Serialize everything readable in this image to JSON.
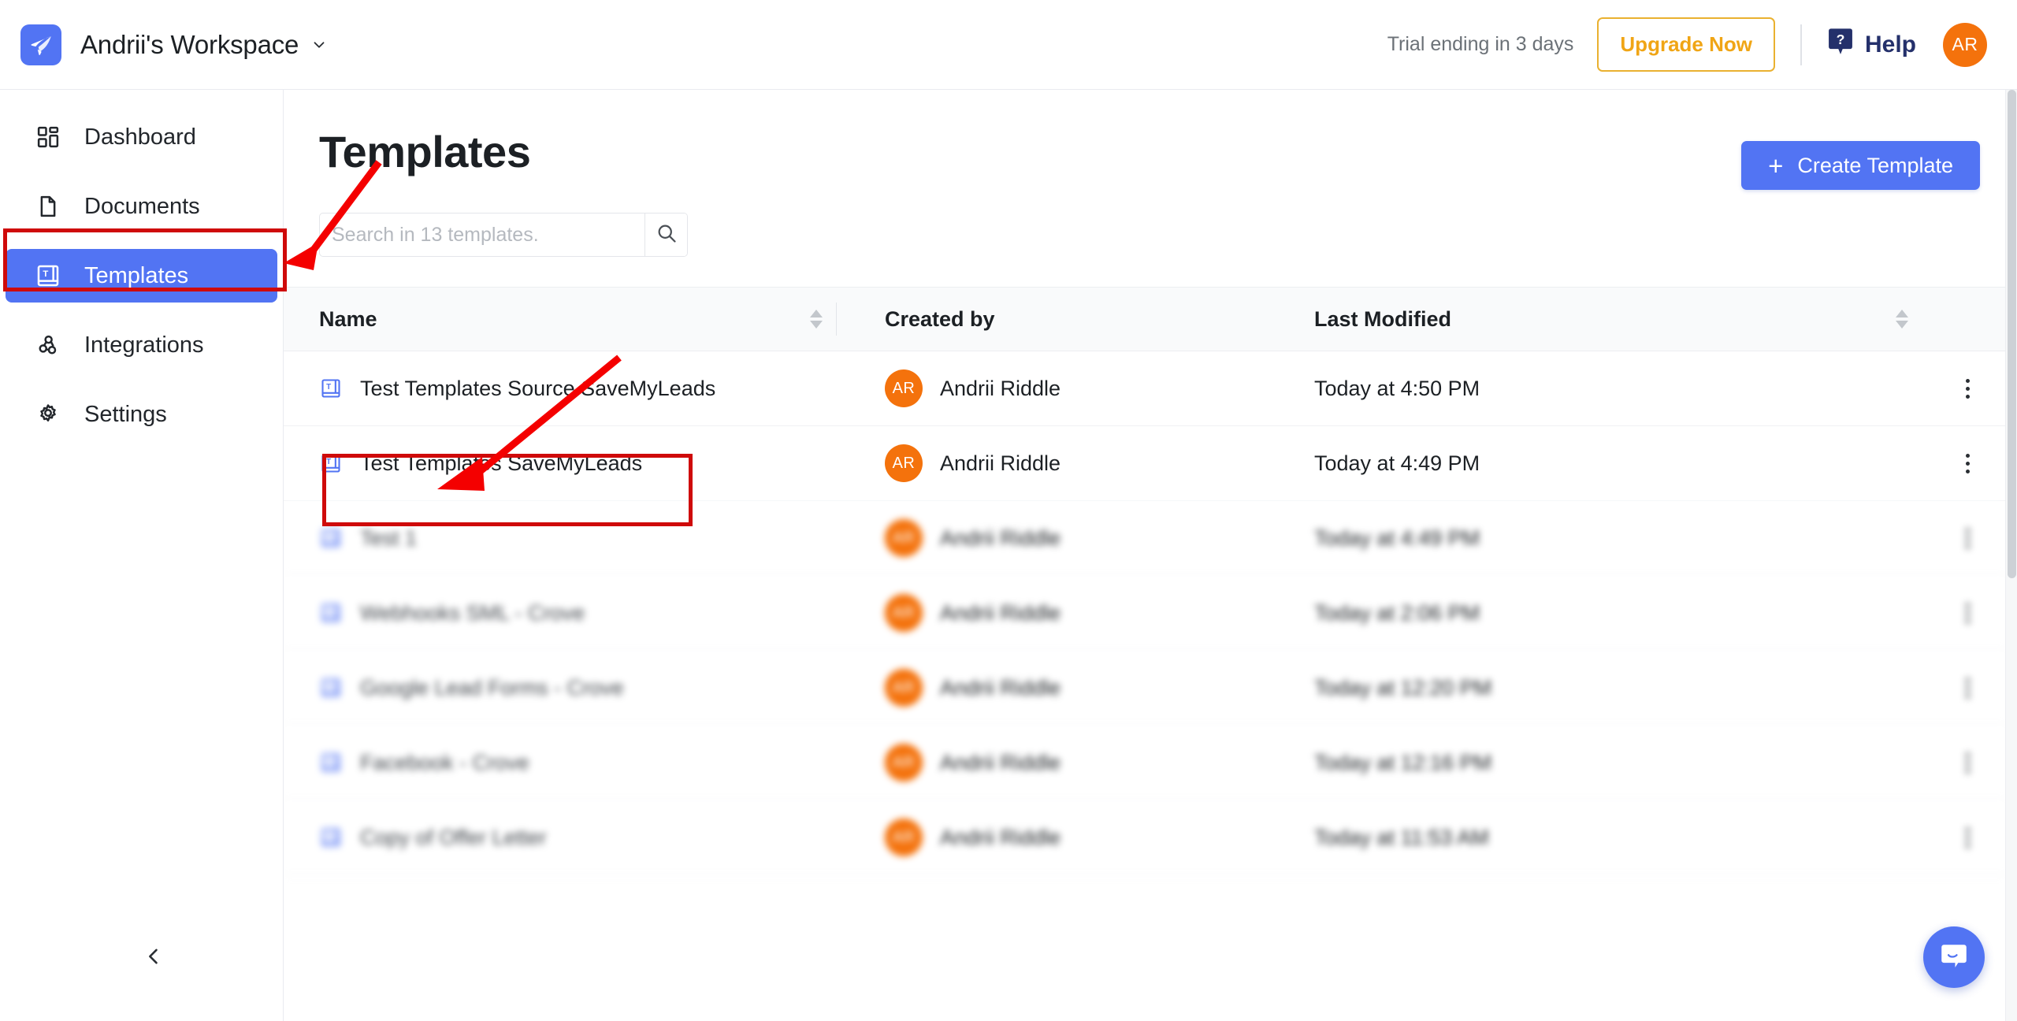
{
  "topbar": {
    "logo_icon": "paper-bird-logo-icon",
    "workspace_name": "Andrii's Workspace",
    "workspace_caret_icon": "chevron-down-icon",
    "trial_text": "Trial ending in 3 days",
    "upgrade_label": "Upgrade Now",
    "help_icon": "help-question-badge-icon",
    "help_label": "Help",
    "avatar_initials": "AR",
    "accent_blue": "#5274f3",
    "accent_orange": "#f4720c",
    "upgrade_amber": "#f0a515",
    "help_navy": "#24306b"
  },
  "sidebar": {
    "items": [
      {
        "label": "Dashboard",
        "icon": "grid-dashboard-icon",
        "active": false
      },
      {
        "label": "Documents",
        "icon": "document-page-icon",
        "active": false
      },
      {
        "label": "Templates",
        "icon": "template-book-icon",
        "active": true
      },
      {
        "label": "Integrations",
        "icon": "webhook-icon",
        "active": false
      },
      {
        "label": "Settings",
        "icon": "gear-icon",
        "active": false
      }
    ],
    "collapse_icon": "chevron-left-icon"
  },
  "main": {
    "title": "Templates",
    "create_button": {
      "label": "Create Template",
      "icon": "plus-icon"
    },
    "search": {
      "placeholder": "Search in 13 templates.",
      "value": "",
      "icon": "search-icon"
    }
  },
  "table": {
    "columns": [
      {
        "key": "name",
        "label": "Name",
        "sortable": true
      },
      {
        "key": "created_by",
        "label": "Created by",
        "sortable": false
      },
      {
        "key": "last_modified",
        "label": "Last Modified",
        "sortable": true
      }
    ],
    "row_menu_icon": "kebab-menu-icon",
    "sort_icon": "sort-arrows-icon",
    "rows": [
      {
        "name": "Test Templates Source SaveMyLeads",
        "icon": "template-book-icon",
        "blurred": false,
        "created_by": "Andrii Riddle",
        "avatar": "AR",
        "last_modified": "Today at 4:50 PM"
      },
      {
        "name": "Test Templates SaveMyLeads",
        "icon": "template-book-icon",
        "blurred": false,
        "created_by": "Andrii Riddle",
        "avatar": "AR",
        "last_modified": "Today at 4:49 PM"
      },
      {
        "name": "Test 1",
        "icon": "template-book-icon",
        "blurred": true,
        "created_by": "Andrii Riddle",
        "avatar": "AR",
        "last_modified": "Today at 4:49 PM"
      },
      {
        "name": "Webhooks SML - Crove",
        "icon": "template-book-icon",
        "blurred": true,
        "created_by": "Andrii Riddle",
        "avatar": "AR",
        "last_modified": "Today at 2:06 PM"
      },
      {
        "name": "Google Lead Forms - Crove",
        "icon": "template-book-icon",
        "blurred": true,
        "created_by": "Andrii Riddle",
        "avatar": "AR",
        "last_modified": "Today at 12:20 PM"
      },
      {
        "name": "Facebook - Crove",
        "icon": "template-book-icon",
        "blurred": true,
        "created_by": "Andrii Riddle",
        "avatar": "AR",
        "last_modified": "Today at 12:16 PM"
      },
      {
        "name": "Copy of  Offer Letter",
        "icon": "template-book-icon",
        "blurred": true,
        "created_by": "Andrii Riddle",
        "avatar": "AR",
        "last_modified": "Today at 11:53 AM"
      }
    ]
  },
  "annotations": {
    "color": "#cf0a0a",
    "boxes": [
      {
        "target": "sidebar-item-templates"
      },
      {
        "target": "table-row-test-templates-savemyleads"
      }
    ],
    "arrows": [
      {
        "from": "page-title-area",
        "to": "sidebar-item-templates"
      },
      {
        "from": "table-header-area",
        "to": "table-row-test-templates-savemyleads"
      }
    ]
  },
  "intercom": {
    "icon": "intercom-chat-bubble-icon",
    "color": "#5274f3"
  }
}
